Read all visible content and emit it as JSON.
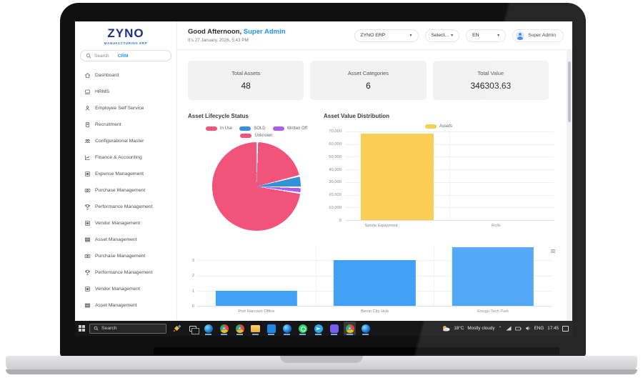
{
  "sidebar": {
    "logo_text": "ZYNO",
    "logo_tagline": "MANUFACTURING ERP",
    "search_placeholder": "Search",
    "search_context": "CRM",
    "items": [
      {
        "label": "Dashboard",
        "icon": "home-icon"
      },
      {
        "label": "HRMS",
        "icon": "laptop-icon"
      },
      {
        "label": "Employee Self Service",
        "icon": "user-icon"
      },
      {
        "label": "Recruitment",
        "icon": "document-icon"
      },
      {
        "label": "Configurational Master",
        "icon": "users-gear-icon"
      },
      {
        "label": "Finance & Accounting",
        "icon": "chart-icon"
      },
      {
        "label": "Expense Management",
        "icon": "list-icon"
      },
      {
        "label": "Purchase Management",
        "icon": "money-icon"
      },
      {
        "label": "Performance Management",
        "icon": "trophy-icon"
      },
      {
        "label": "Vendor Management",
        "icon": "list-icon"
      },
      {
        "label": "Asset Management",
        "icon": "grid-icon"
      },
      {
        "label": "Purchase Management",
        "icon": "money-icon"
      },
      {
        "label": "Performance Management",
        "icon": "trophy-icon"
      },
      {
        "label": "Vendor Management",
        "icon": "list-icon"
      },
      {
        "label": "Asset Management",
        "icon": "grid-icon"
      }
    ]
  },
  "header": {
    "greeting": "Good Afternoon,",
    "user_name": "Super Admin",
    "date_line": "It's 27 January, 2026, 5:43 PM",
    "erp_select": "ZYNO ERP",
    "module_select": "Select...",
    "language_select": "EN",
    "profile_name": "Super Admin"
  },
  "stats": [
    {
      "label": "Total Assets",
      "value": "48"
    },
    {
      "label": "Asset Categories",
      "value": "6"
    },
    {
      "label": "Total Value",
      "value": "346303.63"
    }
  ],
  "chart_data": [
    {
      "type": "pie",
      "title": "Asset Lifecycle Status",
      "legend_position": "top",
      "total": 48,
      "slices": [
        {
          "label": "In Use",
          "value": 10,
          "color": "#F1537B"
        },
        {
          "label": "SOLD",
          "value": 2,
          "color": "#3191DB"
        },
        {
          "label": "Written Off",
          "value": 1,
          "color": "#A95EEF"
        },
        {
          "label": "Unknown",
          "value": 35,
          "color": "#F1537B"
        }
      ]
    },
    {
      "type": "bar",
      "title": "Asset Value Distribution",
      "legend": [
        {
          "label": "Assets",
          "color": "#F9CE55"
        }
      ],
      "categories": [
        "Sports Equipment",
        "Rolls"
      ],
      "values": [
        68500,
        0
      ],
      "bar_color": "#F9CE55",
      "ylim": [
        0,
        70000
      ],
      "yticks": [
        "70,000",
        "60,000",
        "50,000",
        "40,000",
        "30,000",
        "20,000",
        "10,000",
        "0"
      ],
      "grid": true
    },
    {
      "type": "bar",
      "title": "",
      "categories": [
        "Port Harcourt Office",
        "Benin City Hub",
        "Enugu Tech Park"
      ],
      "values": [
        1,
        3,
        4
      ],
      "bar_color": "#42A1F5",
      "ylim": [
        0,
        4
      ],
      "yticks": [
        "3",
        "2",
        "1",
        "0"
      ],
      "ytick_values": [
        3,
        2,
        1,
        0
      ],
      "grid": true
    }
  ],
  "taskbar": {
    "search_placeholder": "Search",
    "apps": [
      {
        "name": "copilot",
        "running": false
      },
      {
        "name": "task-view",
        "running": false
      },
      {
        "name": "edge",
        "running": true
      },
      {
        "name": "chrome",
        "running": true
      },
      {
        "name": "chrome",
        "running": true
      },
      {
        "name": "file-explorer",
        "running": true
      },
      {
        "name": "photos",
        "running": true
      },
      {
        "name": "edge",
        "running": true
      },
      {
        "name": "whatsapp",
        "running": true
      },
      {
        "name": "telegram",
        "running": true
      },
      {
        "name": "discord",
        "running": true
      },
      {
        "name": "chrome",
        "running": true,
        "active": true
      },
      {
        "name": "edge",
        "running": true
      }
    ],
    "tray": {
      "temperature": "18°C",
      "condition": "Mostly cloudy",
      "language": "ENG",
      "time": "17:45"
    }
  },
  "colors": {
    "accent_blue": "#2196F3",
    "pink": "#F1537B",
    "blue": "#3191DB",
    "purple": "#A95EEF",
    "yellow": "#F9CE55",
    "bar_blue": "#42A1F5"
  }
}
